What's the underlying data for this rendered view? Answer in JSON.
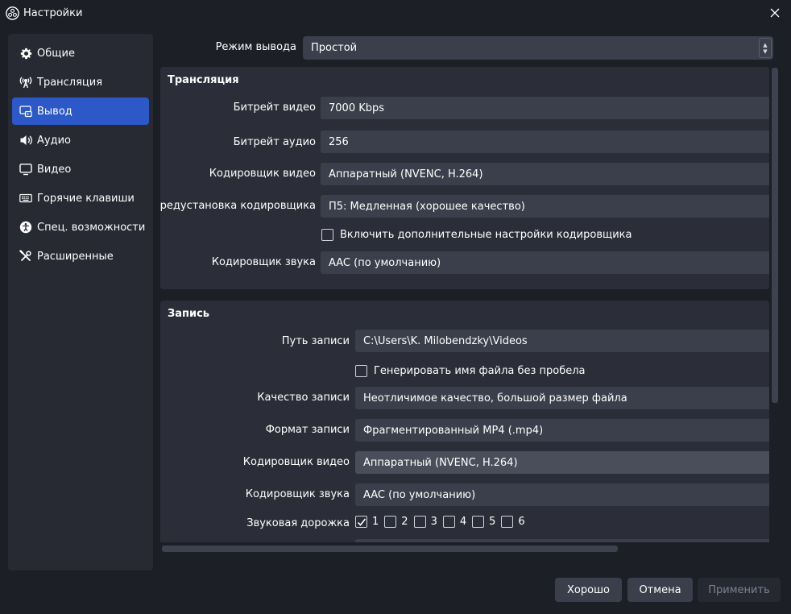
{
  "window": {
    "title": "Настройки",
    "app_icon": "obs-logo-icon",
    "close_icon": "close-icon"
  },
  "sidebar": {
    "items": [
      {
        "label": "Общие",
        "icon": "gear-icon",
        "active": false
      },
      {
        "label": "Трансляция",
        "icon": "antenna-icon",
        "active": false
      },
      {
        "label": "Вывод",
        "icon": "output-icon",
        "active": true
      },
      {
        "label": "Аудио",
        "icon": "speaker-icon",
        "active": false
      },
      {
        "label": "Видео",
        "icon": "monitor-icon",
        "active": false
      },
      {
        "label": "Горячие клавиши",
        "icon": "keyboard-icon",
        "active": false
      },
      {
        "label": "Спец. возможности",
        "icon": "accessibility-icon",
        "active": false
      },
      {
        "label": "Расширенные",
        "icon": "wrench-screwdriver-icon",
        "active": false
      }
    ]
  },
  "output_mode": {
    "label": "Режим вывода",
    "value": "Простой"
  },
  "streaming": {
    "title": "Трансляция",
    "video_bitrate": {
      "label": "Битрейт видео",
      "value": "7000 Kbps"
    },
    "audio_bitrate": {
      "label": "Битрейт аудио",
      "value": "256"
    },
    "video_encoder": {
      "label": "Кодировщик видео",
      "value": "Аппаратный (NVENC, H.264)"
    },
    "encoder_preset": {
      "label": "Предустановка кодировщика",
      "value": "П5: Медленная (хорошее качество)"
    },
    "advanced_settings": {
      "label": "Включить дополнительные настройки кодировщика",
      "checked": false
    },
    "audio_encoder": {
      "label": "Кодировщик звука",
      "value": "AAC (по умолчанию)"
    }
  },
  "recording": {
    "title": "Запись",
    "path": {
      "label": "Путь записи",
      "value": "C:\\Users\\K. Milobendzky\\Videos"
    },
    "no_space": {
      "label": "Генерировать имя файла без пробела",
      "checked": false
    },
    "quality": {
      "label": "Качество записи",
      "value": "Неотличимое качество, большой размер файла"
    },
    "format": {
      "label": "Формат записи",
      "value": "Фрагментированный MP4 (.mp4)"
    },
    "video_encoder": {
      "label": "Кодировщик видео",
      "value": "Аппаратный (NVENC, H.264)"
    },
    "audio_encoder": {
      "label": "Кодировщик звука",
      "value": "AAC (по умолчанию)"
    },
    "audio_tracks": {
      "label": "Звуковая дорожка",
      "tracks": [
        {
          "label": "1",
          "checked": true
        },
        {
          "label": "2",
          "checked": false
        },
        {
          "label": "3",
          "checked": false
        },
        {
          "label": "4",
          "checked": false
        },
        {
          "label": "5",
          "checked": false
        },
        {
          "label": "6",
          "checked": false
        }
      ]
    }
  },
  "buttons": {
    "ok": "Хорошо",
    "cancel": "Отмена",
    "apply": "Применить"
  },
  "colors": {
    "background": "#1d1f26",
    "panel": "#2b2e38",
    "field": "#3b3f4b",
    "accent": "#2c58c8"
  }
}
